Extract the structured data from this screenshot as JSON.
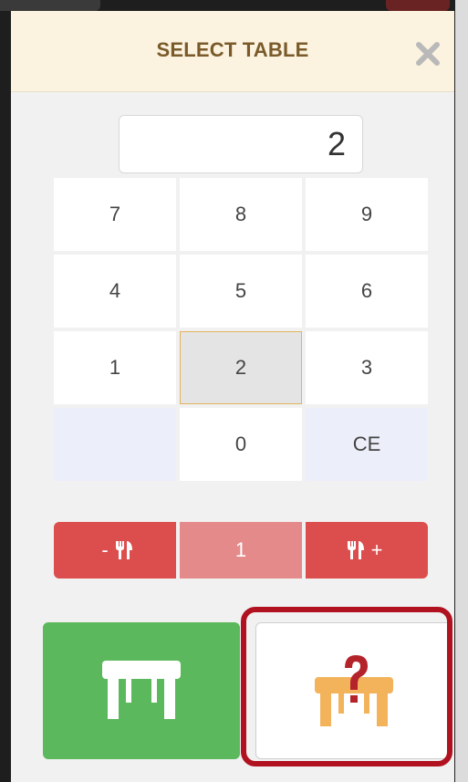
{
  "modal": {
    "title": "SELECT TABLE",
    "close_icon": "close-icon"
  },
  "display": {
    "value": "2"
  },
  "keypad": {
    "keys": [
      "7",
      "8",
      "9",
      "4",
      "5",
      "6",
      "1",
      "2",
      "3",
      "",
      "0",
      "CE"
    ],
    "selected": "2"
  },
  "covers": {
    "minus_label": "-",
    "count": "1",
    "plus_label": "+"
  },
  "buttons": {
    "assign_table_icon": "table-icon",
    "unknown_table_icon": "table-question-icon"
  },
  "colors": {
    "header_bg": "#fbf3df",
    "title": "#7a5a2a",
    "cover_red": "#dc4d4d",
    "cover_count": "#e58a8a",
    "green": "#5cb85c",
    "highlight": "#b0121f",
    "table_orange": "#f2b35a",
    "question_red": "#b4232a"
  }
}
